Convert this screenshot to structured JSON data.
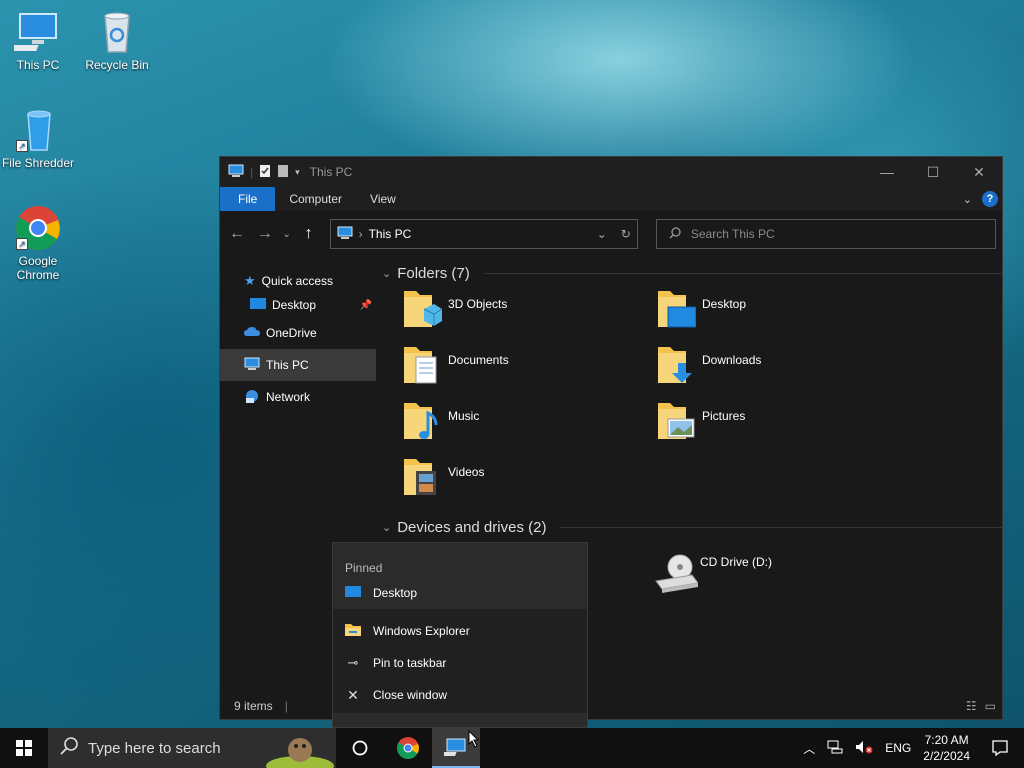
{
  "desktop": {
    "icons": [
      {
        "label": "This PC"
      },
      {
        "label": "Recycle Bin"
      },
      {
        "label": "File Shredder"
      },
      {
        "label": "Google Chrome"
      }
    ]
  },
  "window": {
    "title": "This PC",
    "ribbon_tabs": [
      "File",
      "Computer",
      "View"
    ],
    "address": "This PC",
    "search_placeholder": "Search This PC",
    "nav": {
      "quick_access": "Quick access",
      "desktop": "Desktop",
      "onedrive": "OneDrive",
      "this_pc": "This PC",
      "network": "Network"
    },
    "folders_header": "Folders (7)",
    "folders": [
      "3D Objects",
      "Desktop",
      "Documents",
      "Downloads",
      "Music",
      "Pictures",
      "Videos"
    ],
    "devices_header": "Devices and drives (2)",
    "drives": [
      "CD Drive (D:)"
    ],
    "status": "9 items"
  },
  "jumplist": {
    "pinned_header": "Pinned",
    "pinned_items": [
      "Desktop"
    ],
    "actions": [
      "Windows Explorer",
      "Pin to taskbar",
      "Close window"
    ]
  },
  "taskbar": {
    "search_placeholder": "Type here to search",
    "language": "ENG",
    "time": "7:20 AM",
    "date": "2/2/2024"
  },
  "colors": {
    "accent": "#1a6fc9",
    "folder": "#f3c34b",
    "window_bg": "#191919"
  }
}
